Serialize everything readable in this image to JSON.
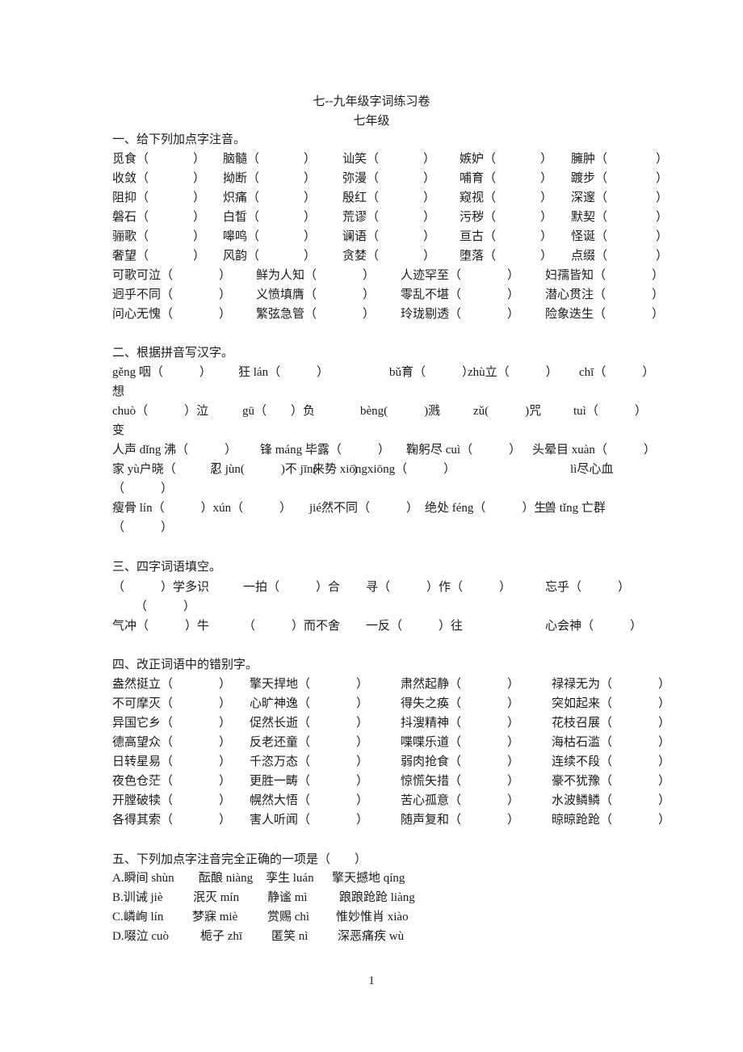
{
  "title": "七--九年级字词练习卷",
  "subtitle": "七年级",
  "section1": {
    "heading": "一、给下列加点字注音。",
    "rows": [
      [
        "觅食",
        "脑髓",
        "讪笑",
        "嫉妒",
        "臃肿"
      ],
      [
        "收敛",
        "拗断",
        "弥漫",
        "哺育",
        "踱步"
      ],
      [
        "阻抑",
        "炽痛",
        "殷红",
        "窥视",
        "深邃"
      ],
      [
        "磐石",
        "白皙",
        "荒谬",
        "污秽",
        "默契"
      ],
      [
        "骊歌",
        "嗥鸣",
        "谰语",
        "亘古",
        "怪诞"
      ],
      [
        "奢望",
        "风韵",
        "贪婪",
        "堕落",
        "点缀"
      ]
    ],
    "idiom_rows": [
      [
        "可歌可泣",
        "鲜为人知",
        "人迹罕至",
        "妇孺皆知"
      ],
      [
        "迥乎不同",
        "义愤填膺",
        "零乱不堪",
        "潜心贯注"
      ],
      [
        "问心无愧",
        "繁弦急管",
        "玲珑剔透",
        "险象迭生"
      ]
    ]
  },
  "section2": {
    "heading": "二、根据拼音写汉字。",
    "lines": [
      {
        "items": [
          "gěng 咽（　　　）",
          "狂 lán（　　　）",
          "bǔ育（　　　）",
          "zhù立（　　　）",
          "chī（　　　）"
        ],
        "wrap": "想"
      },
      {
        "items": [
          "chuò（　　　）泣",
          "gū（　　）负",
          "bèng(　　　)溅",
          "zǔ(　　　)咒",
          "tuì（　　　）"
        ],
        "wrap": "变"
      },
      {
        "items": [
          "人声 dǐng 沸（　　　）",
          "锋 máng 毕露（　　　）",
          "鞠躬尽 cuì（　　　）",
          "头晕目 xuàn（　　　）"
        ],
        "wrap": ""
      },
      {
        "items": [
          "家 yù户晓（　　　）",
          "忍 jùn(　　　)不 jīn(　　　)",
          "来势 xiōngxiōng（　　　）",
          "lì尽心血"
        ],
        "wrap": "（　　　）"
      },
      {
        "items": [
          "瘦骨 lín（　　　）xún（　　　）",
          "jié然不同（　　　）",
          "绝处 féng（　　　）生",
          "兽 tǐng 亡群"
        ],
        "wrap": "（　　　）"
      }
    ]
  },
  "section3": {
    "heading": "三、四字词语填空。",
    "line1": [
      "（　　　）学多识",
      "一拍（　　　）合",
      "寻（　　　）作（　　　）",
      "忘乎（　　　）"
    ],
    "line1_wrap": "（　　　）",
    "line2": [
      "气冲（　　　）牛",
      "（　　　）而不舍",
      "一反（　　　）往",
      "心会神（　　　）"
    ]
  },
  "section4": {
    "heading": "四、改正词语中的错别字。",
    "rows": [
      [
        "盎然挺立",
        "擎天捍地",
        "肃然起静",
        "禄禄无为"
      ],
      [
        "不可摩灭",
        "心旷神逸",
        "得失之痪",
        "突如起来"
      ],
      [
        "异国它乡",
        "促然长逝",
        "抖溲精神",
        "花枝召展"
      ],
      [
        "德高望众",
        "反老还童",
        "喋喋乐道",
        "海枯石滥"
      ],
      [
        "日转星易",
        "千恣万态",
        "弱肉抢食",
        "连续不段"
      ],
      [
        "夜色仓茫",
        "更胜一畴",
        "惊慌矢措",
        "豪不犹豫"
      ],
      [
        "开膛破犊",
        "幌然大悟",
        "苦心孤意",
        "水波鳞鳞"
      ],
      [
        "各得其索",
        "害人听闻",
        "随声复和",
        "晾晾跄跄"
      ]
    ]
  },
  "section5": {
    "heading": "五、下列加点字注音完全正确的一项是（　　）",
    "options": [
      {
        "label": "A.",
        "items": [
          "瞬间 shùn",
          "酝酿 niàng",
          "孪生 luán",
          "擎天撼地 qíng"
        ]
      },
      {
        "label": "B.",
        "items": [
          "训诫 jiè",
          "泯灭 mín",
          "静谧 mì",
          "踉踉跄跄 liàng"
        ]
      },
      {
        "label": "C.",
        "items": [
          "嶙峋 lín",
          "梦寐 miè",
          "赏赐 chì",
          "惟妙惟肖 xiào"
        ]
      },
      {
        "label": "D.",
        "items": [
          "啜泣 cuò",
          "栀子 zhī",
          "匿笑 nì",
          "深恶痛疾 wù"
        ]
      }
    ]
  },
  "page_number": "1"
}
